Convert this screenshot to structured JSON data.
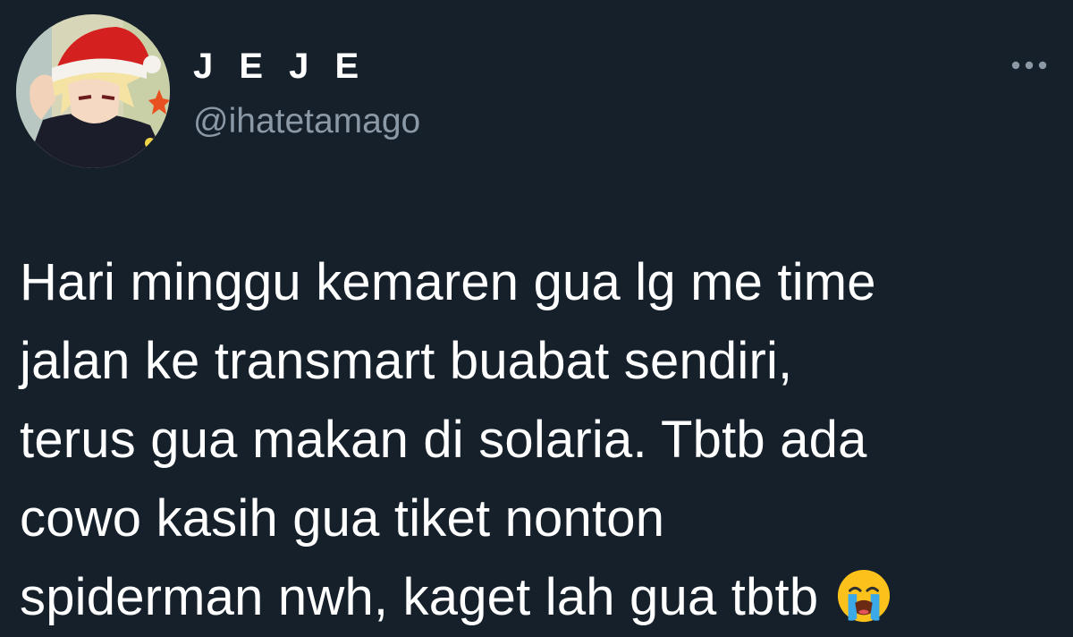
{
  "tweet": {
    "author": {
      "display_name": "J E J E",
      "handle": "@ihatetamago",
      "avatar": "avatar-icon"
    },
    "more_icon": "more-options-icon",
    "text_lines": [
      "Hari minggu kemaren gua lg me time",
      "jalan ke transmart buabat sendiri,",
      "terus gua makan di solaria. Tbtb ada",
      "cowo kasih gua tiket nonton",
      "spiderman nwh, kaget lah gua tbtb"
    ],
    "emoji": "loudly-crying-face-icon"
  },
  "colors": {
    "background": "#15202b",
    "text": "#ffffff",
    "secondary_text": "#8b98a5"
  }
}
